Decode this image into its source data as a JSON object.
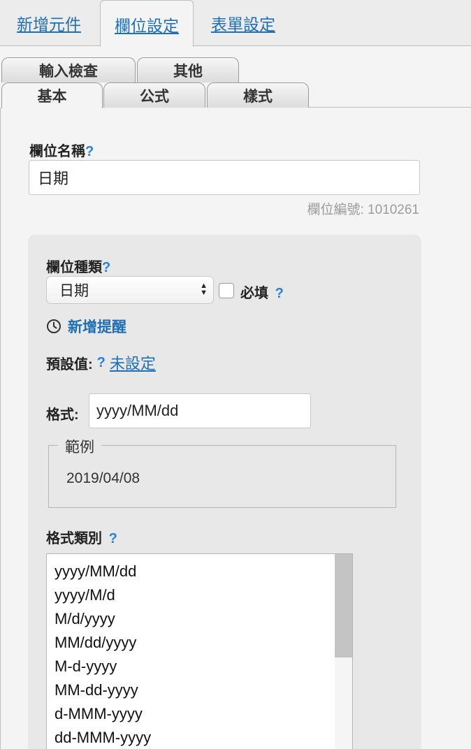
{
  "top_tabs": [
    {
      "label": "新增元件"
    },
    {
      "label": "欄位設定"
    },
    {
      "label": "表單設定"
    }
  ],
  "sub_tabs": {
    "row1": [
      {
        "label": "輸入檢查"
      },
      {
        "label": "其他"
      }
    ],
    "row2": [
      {
        "label": "基本"
      },
      {
        "label": "公式"
      },
      {
        "label": "樣式"
      }
    ]
  },
  "field_name": {
    "label": "欄位名稱",
    "help": "?",
    "value": "日期",
    "field_no": "欄位編號: 1010261"
  },
  "field_type": {
    "label": "欄位種類",
    "help": "?",
    "selected": "日期",
    "required_label": "必填",
    "required_help": "?",
    "required_checked": false
  },
  "reminder": {
    "label": "新增提醒",
    "icon": "clock-icon"
  },
  "default_value": {
    "label": "預設值:",
    "help": "?",
    "link": "未設定"
  },
  "format": {
    "label": "格式:",
    "value": "yyyy/MM/dd"
  },
  "example": {
    "legend": "範例",
    "value": "2019/04/08"
  },
  "format_category": {
    "label": "格式類別",
    "help": "?",
    "options": [
      "yyyy/MM/dd",
      "yyyy/M/d",
      "M/d/yyyy",
      "MM/dd/yyyy",
      "M-d-yyyy",
      "MM-dd-yyyy",
      "d-MMM-yyyy",
      "dd-MMM-yyyy"
    ]
  },
  "colors": {
    "link": "#1f6fb5",
    "help": "#2a7fd4",
    "panel": "#e8e8e8"
  }
}
